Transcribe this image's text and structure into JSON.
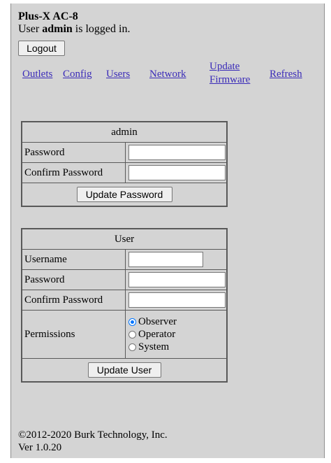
{
  "header": {
    "title": "Plus-X AC-8",
    "login_prefix": "User ",
    "login_user": "admin",
    "login_suffix": " is logged in.",
    "logout_label": "Logout"
  },
  "nav": {
    "outlets": "Outlets",
    "config": "Config",
    "users": "Users",
    "network": "Network",
    "update_line1": "Update",
    "update_line2": "Firmware",
    "refresh": "Refresh"
  },
  "password_form": {
    "heading": "admin",
    "password_label": "Password",
    "password_value": "",
    "confirm_label": "Confirm Password",
    "confirm_value": "",
    "submit_label": "Update Password"
  },
  "user_form": {
    "heading": "User",
    "username_label": "Username",
    "username_value": "",
    "password_label": "Password",
    "password_value": "",
    "confirm_label": "Confirm Password",
    "confirm_value": "",
    "permissions_label": "Permissions",
    "permissions_options": [
      "Observer",
      "Operator",
      "System"
    ],
    "permissions_selected": "Observer",
    "submit_label": "Update User"
  },
  "footer": {
    "copyright": "©2012-2020 Burk Technology, Inc.",
    "version": "Ver 1.0.20"
  },
  "colors": {
    "panel_bg": "#d4d4d4",
    "link": "#3a2bb8",
    "radio_selected": "#0075ff"
  }
}
